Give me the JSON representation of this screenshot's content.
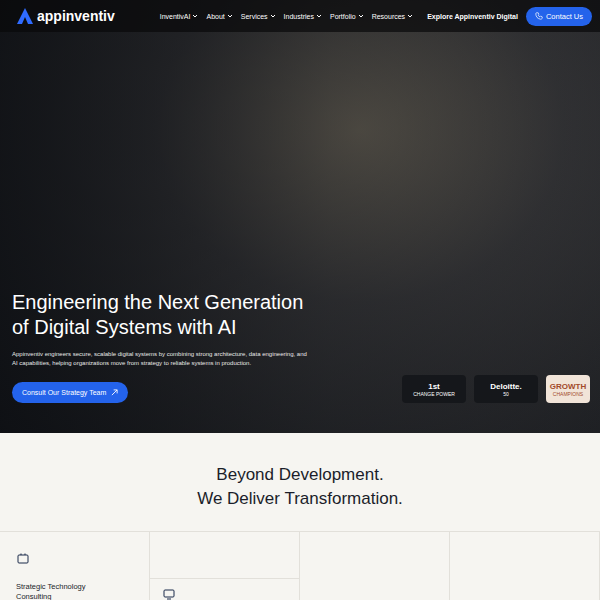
{
  "header": {
    "logo": "appinventiv",
    "nav": [
      {
        "label": "InventivAI",
        "dropdown": true
      },
      {
        "label": "About",
        "dropdown": true
      },
      {
        "label": "Services",
        "dropdown": true
      },
      {
        "label": "Industries",
        "dropdown": true
      },
      {
        "label": "Portfolio",
        "dropdown": true
      },
      {
        "label": "Resources",
        "dropdown": true
      },
      {
        "label": "Explore Appinventiv Digital",
        "dropdown": false
      }
    ],
    "cta": "Contact Us"
  },
  "hero": {
    "title": "Engineering the Next Generation of Digital Systems with AI",
    "subtitle": "Appinventiv engineers secure, scalable digital systems by combining strong architecture, data engineering, and AI capabilities, helping organizations move from strategy to reliable systems in production.",
    "button": "Consult Our Strategy Team",
    "badges": [
      {
        "title": "1st",
        "label": "CHANGE POWER",
        "kind": "dark"
      },
      {
        "title": "Deloitte.",
        "label": "50",
        "kind": "dark"
      },
      {
        "title": "GROWTH",
        "label": "CHAMPIONS",
        "kind": "light"
      }
    ]
  },
  "section": {
    "line1": "Beyond Development.",
    "line2": "We Deliver Transformation.",
    "columns": [
      {
        "kind": "card",
        "title": "Strategic Technology Consulting"
      },
      {
        "kind": "offset",
        "title": ""
      },
      {
        "kind": "empty",
        "title": ""
      },
      {
        "kind": "empty",
        "title": ""
      }
    ]
  }
}
